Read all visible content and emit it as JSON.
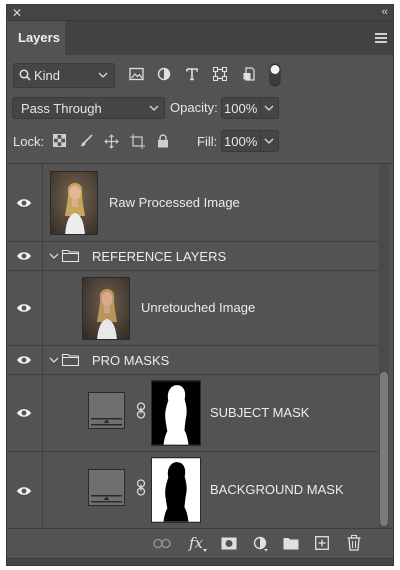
{
  "window": {
    "close_glyph": "✕",
    "collapse_glyph": "‹‹"
  },
  "tabs": {
    "active_label": "Layers"
  },
  "filter": {
    "kind_label": "Kind",
    "icons": [
      "image-filter-icon",
      "adjustment-filter-icon",
      "type-filter-icon",
      "shape-filter-icon",
      "smart-object-filter-icon",
      "filter-toggle-icon"
    ]
  },
  "blend": {
    "mode": "Pass Through",
    "opacity_label": "Opacity:",
    "opacity_value": "100%"
  },
  "lock": {
    "label": "Lock:",
    "fill_label": "Fill:",
    "fill_value": "100%"
  },
  "layers": [
    {
      "type": "pixel",
      "name": "Raw Processed Image",
      "visible": true
    },
    {
      "type": "group",
      "name": "REFERENCE LAYERS",
      "visible": true,
      "expanded": true
    },
    {
      "type": "pixel",
      "name": "Unretouched Image",
      "visible": true,
      "indent": 1
    },
    {
      "type": "group",
      "name": "PRO MASKS",
      "visible": true,
      "expanded": true
    },
    {
      "type": "mask",
      "name": "SUBJECT MASK",
      "visible": true,
      "indent": 1
    },
    {
      "type": "mask",
      "name": "BACKGROUND MASK",
      "visible": true,
      "indent": 1,
      "inverted": true
    }
  ],
  "scroll": {
    "position": 0.57
  },
  "bottom_toolbar": {
    "fx_label": "fx"
  },
  "colors": {
    "panel": "#535353",
    "dark": "#424242",
    "field": "#454545",
    "text": "#e6e6e6"
  }
}
